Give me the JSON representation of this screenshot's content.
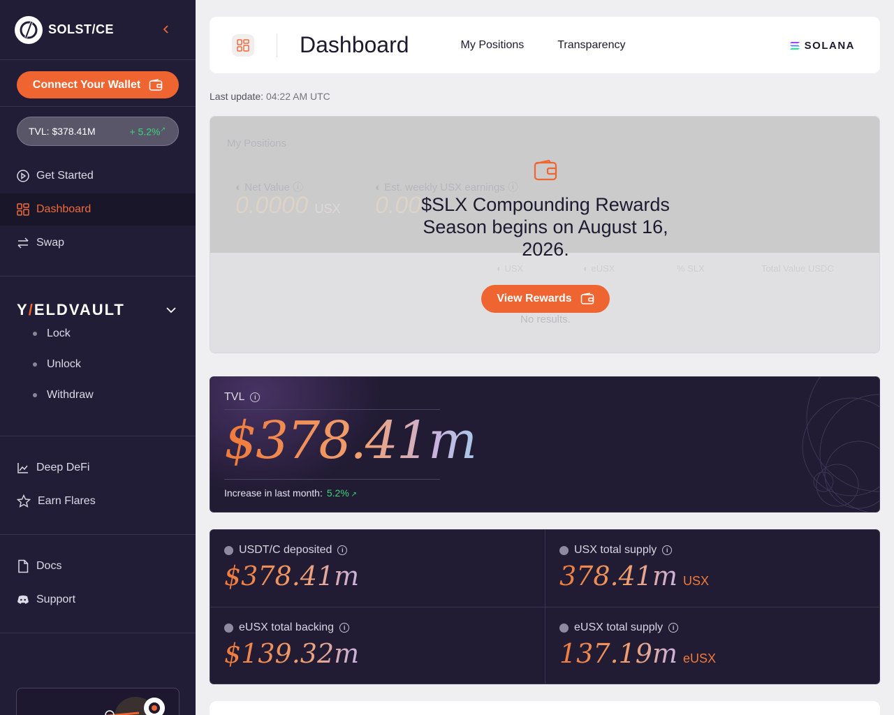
{
  "brand": {
    "name": "SOLST/CE"
  },
  "sidebar": {
    "connect_wallet": "Connect Your Wallet",
    "tvl_text": "TVL: $378.41M",
    "tvl_change": "+ 5.2%",
    "nav": [
      {
        "label": "Get Started",
        "icon": "play-circle-icon"
      },
      {
        "label": "Dashboard",
        "icon": "grid-icon",
        "active": true
      },
      {
        "label": "Swap",
        "icon": "swap-arrows-icon"
      }
    ],
    "yieldvault": {
      "logo_pre": "Y",
      "logo_slash": "/",
      "logo_post": "ELDVAULT",
      "items": [
        "Lock",
        "Unlock",
        "Withdraw"
      ]
    },
    "misc": [
      {
        "label": "Deep DeFi",
        "icon": "chart-icon"
      },
      {
        "label": "Earn Flares",
        "icon": "star-icon"
      }
    ],
    "docs": [
      {
        "label": "Docs",
        "icon": "document-icon"
      },
      {
        "label": "Support",
        "icon": "discord-icon"
      }
    ]
  },
  "header": {
    "title": "Dashboard",
    "nav": [
      "My Positions",
      "Transparency"
    ],
    "network": "SOLANA"
  },
  "last_update": {
    "label": "Last update:",
    "value": "04:22 AM UTC"
  },
  "positions": {
    "title": "My Positions",
    "net_value_label": "Net Value",
    "net_value": "0.0000",
    "net_value_unit": "USX",
    "weekly_label": "Est. weekly USX earnings",
    "weekly_value": "0.00",
    "columns": [
      "USX",
      "eUSX",
      "SLX",
      "Total Value USDC"
    ],
    "no_results": "No results."
  },
  "overlay": {
    "message": "$SLX Compounding Rewards Season begins on August 16, 2026.",
    "button": "View Rewards"
  },
  "tvl_card": {
    "label": "TVL",
    "value": "$378.41m",
    "increase_label": "Increase in last month:",
    "increase_value": "5.2%"
  },
  "stats": [
    {
      "label": "USDT/C deposited",
      "value": "$378.41m",
      "unit": ""
    },
    {
      "label": "USX total supply",
      "value": "378.41m",
      "unit": "USX"
    },
    {
      "label": "eUSX total backing",
      "value": "$139.32m",
      "unit": ""
    },
    {
      "label": "eUSX total supply",
      "value": "137.19m",
      "unit": "eUSX"
    }
  ],
  "colors": {
    "accent": "#ef6532",
    "sidebar_bg": "#221d36",
    "card_dark": "#211b33",
    "positive": "#3ad67a"
  }
}
